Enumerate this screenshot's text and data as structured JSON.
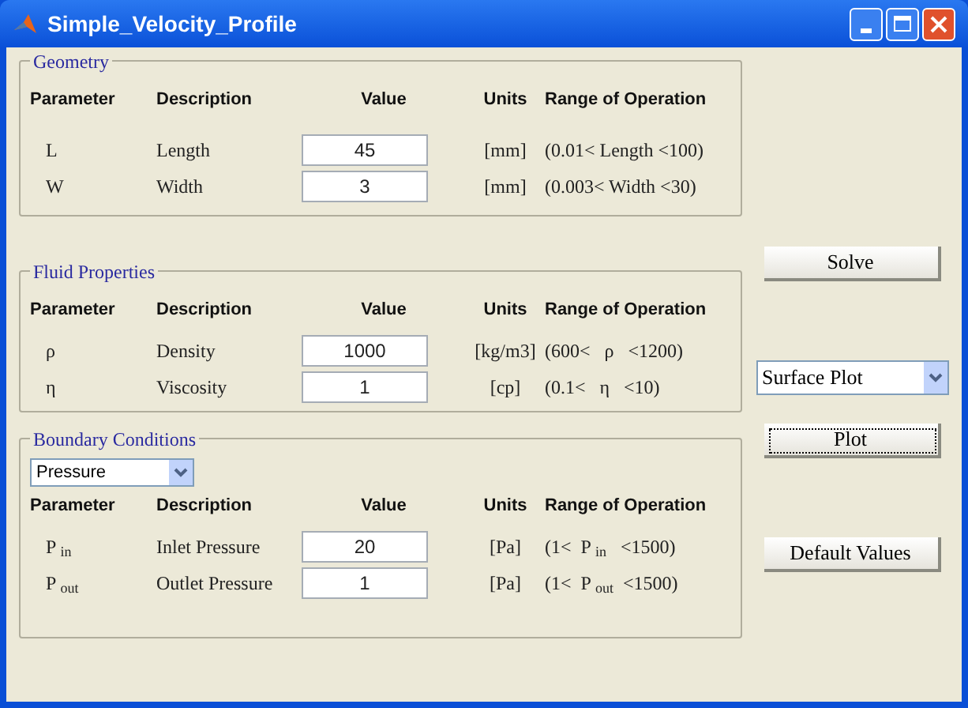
{
  "window": {
    "title": "Simple_Velocity_Profile"
  },
  "sections": [
    {
      "title": "Geometry",
      "columns": [
        "Parameter",
        "Description",
        "Value",
        "Units",
        "Range of Operation"
      ],
      "rows": [
        {
          "symbol": "L",
          "description": "Length",
          "value": "45",
          "units": "[mm]",
          "range": "(0.01< Length <100)"
        },
        {
          "symbol": "W",
          "description": "Width",
          "value": "3",
          "units": "[mm]",
          "range": "(0.003< Width <30)"
        }
      ]
    },
    {
      "title": "Fluid Properties",
      "columns": [
        "Parameter",
        "Description",
        "Value",
        "Units",
        "Range of Operation"
      ],
      "rows": [
        {
          "symbol": "ρ",
          "description": "Density",
          "value": "1000",
          "units": "[kg/m3]",
          "range": "(600<   ρ   <1200)"
        },
        {
          "symbol": "η",
          "description": "Viscosity",
          "value": "1",
          "units": "[cp]",
          "range": "(0.1<   η   <10)"
        }
      ]
    },
    {
      "title": "Boundary Conditions",
      "dropdown": "Pressure",
      "columns": [
        "Parameter",
        "Description",
        "Value",
        "Units",
        "Range of Operation"
      ],
      "rows": [
        {
          "symbol": "P $_{in}$",
          "description": "Inlet Pressure",
          "value": "20",
          "units": "[Pa]",
          "range": "(1<  P $_{in}$   <1500)"
        },
        {
          "symbol": "P $_{out}$",
          "description": "Outlet Pressure",
          "value": "1",
          "units": "[Pa]",
          "range": "(1<  P $_{out}$  <1500)"
        }
      ]
    }
  ],
  "controls": [
    {
      "kind": "button",
      "label": "Solve",
      "focused": false
    },
    {
      "kind": "dropdown",
      "value": "Surface Plot"
    },
    {
      "kind": "button",
      "label": "Plot",
      "focused": true
    },
    {
      "kind": "button",
      "label": "Default Values",
      "focused": false
    }
  ]
}
